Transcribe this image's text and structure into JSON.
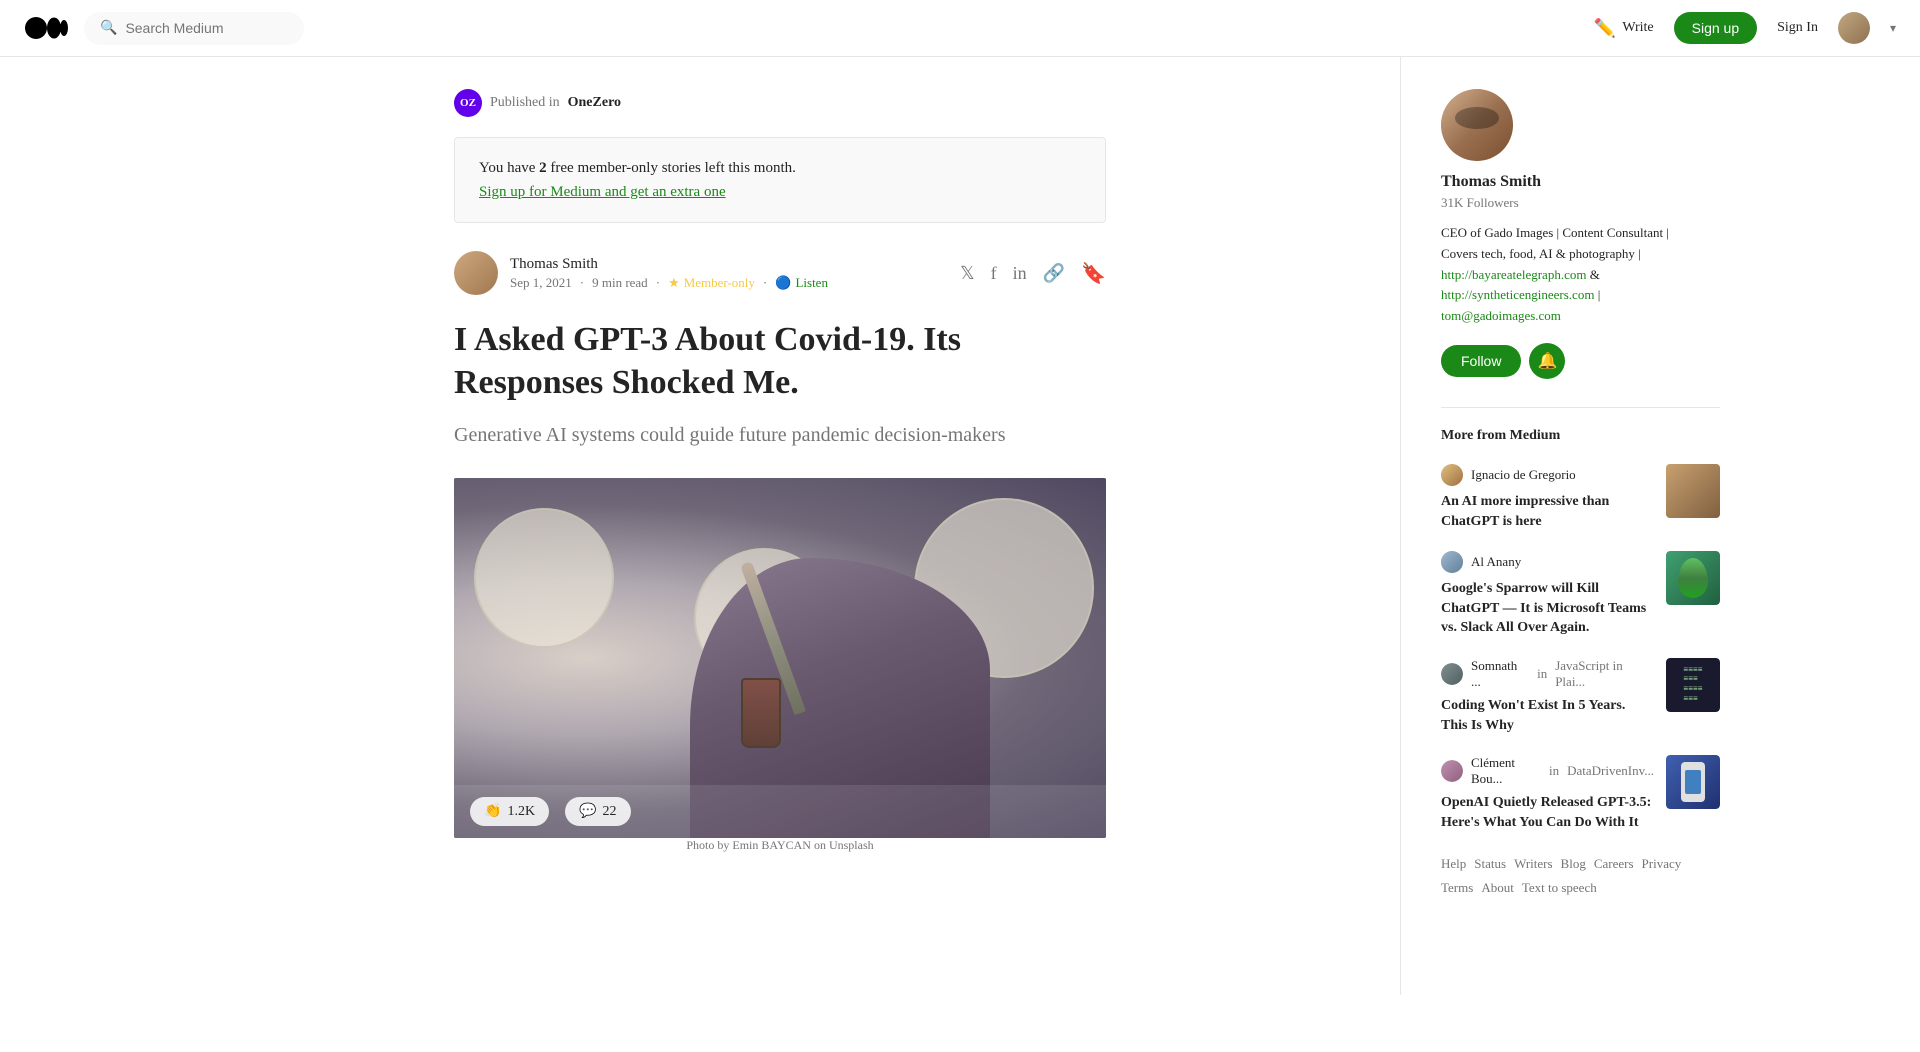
{
  "header": {
    "logo_text": "M",
    "search_placeholder": "Search Medium",
    "write_label": "Write",
    "signup_label": "Sign up",
    "signin_label": "Sign In"
  },
  "published_in": {
    "pub_initials": "OZ",
    "label": "Published in",
    "pub_name": "OneZero"
  },
  "member_banner": {
    "prefix": "You have ",
    "count": "2",
    "suffix": " free member-only stories left this month.",
    "link_text": "Sign up for Medium and get an extra one"
  },
  "article": {
    "author_name": "Thomas Smith",
    "date": "Sep 1, 2021",
    "read_time": "9 min read",
    "member_only": "Member-only",
    "listen_label": "Listen",
    "title": "I Asked GPT-3 About Covid-19. Its Responses Shocked Me.",
    "subtitle": "Generative AI systems could guide future pandemic decision-makers",
    "image_caption": "Photo by Emin BAYCAN on Unsplash",
    "clap_count": "1.2K",
    "comment_count": "22"
  },
  "sidebar": {
    "author": {
      "name": "Thomas Smith",
      "followers": "31K Followers",
      "bio_line1": "CEO of Gado Images | Content Consultant |",
      "bio_line2": "Covers tech, food, AI & photography |",
      "bio_link1": "http://bayareatelegraph.com",
      "bio_and": "&",
      "bio_link2": "http://syntheticengineers.com",
      "bio_separator": "|",
      "bio_link3": "tom@gadoimages.com",
      "follow_label": "Follow"
    },
    "more_from": {
      "title": "More from Medium",
      "items": [
        {
          "author": "Ignacio de Gregorio",
          "pub": "",
          "title": "An AI more impressive than ChatGPT is here"
        },
        {
          "author": "Al Anany",
          "pub": "",
          "title": "Google's Sparrow will Kill ChatGPT — It is Microsoft Teams vs. Slack All Over Again."
        },
        {
          "author": "Somnath ...",
          "pub_prefix": "in",
          "pub": "JavaScript in Plai...",
          "title": "Coding Won't Exist In 5 Years. This Is Why"
        },
        {
          "author": "Clément Bou...",
          "pub_prefix": "in",
          "pub": "DataDrivenInv...",
          "title": "OpenAI Quietly Released GPT-3.5: Here's What You Can Do With It"
        }
      ]
    },
    "footer_links": [
      "Help",
      "Status",
      "Writers",
      "Blog",
      "Careers",
      "Privacy",
      "Terms",
      "About",
      "Text to speech"
    ]
  }
}
